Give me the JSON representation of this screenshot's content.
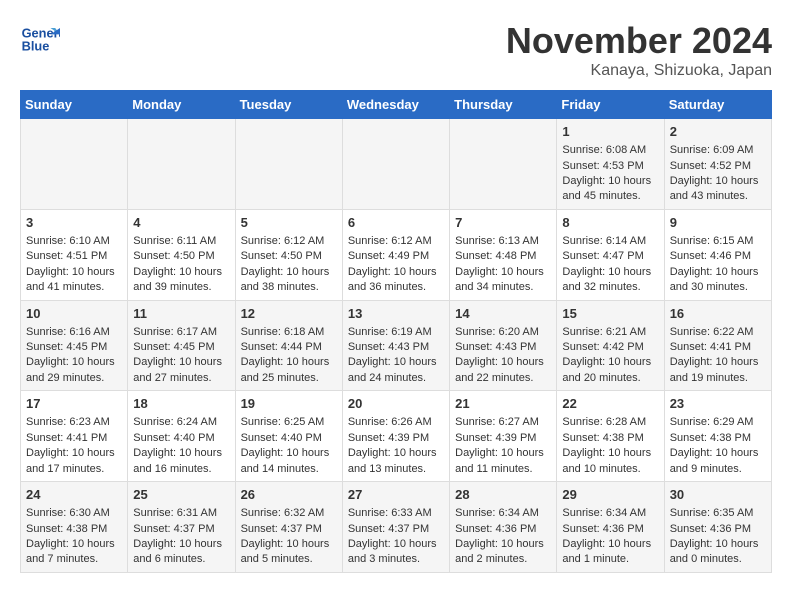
{
  "header": {
    "logo_line1": "General",
    "logo_line2": "Blue",
    "month": "November 2024",
    "location": "Kanaya, Shizuoka, Japan"
  },
  "weekdays": [
    "Sunday",
    "Monday",
    "Tuesday",
    "Wednesday",
    "Thursday",
    "Friday",
    "Saturday"
  ],
  "weeks": [
    [
      {
        "day": "",
        "info": ""
      },
      {
        "day": "",
        "info": ""
      },
      {
        "day": "",
        "info": ""
      },
      {
        "day": "",
        "info": ""
      },
      {
        "day": "",
        "info": ""
      },
      {
        "day": "1",
        "info": "Sunrise: 6:08 AM\nSunset: 4:53 PM\nDaylight: 10 hours\nand 45 minutes."
      },
      {
        "day": "2",
        "info": "Sunrise: 6:09 AM\nSunset: 4:52 PM\nDaylight: 10 hours\nand 43 minutes."
      }
    ],
    [
      {
        "day": "3",
        "info": "Sunrise: 6:10 AM\nSunset: 4:51 PM\nDaylight: 10 hours\nand 41 minutes."
      },
      {
        "day": "4",
        "info": "Sunrise: 6:11 AM\nSunset: 4:50 PM\nDaylight: 10 hours\nand 39 minutes."
      },
      {
        "day": "5",
        "info": "Sunrise: 6:12 AM\nSunset: 4:50 PM\nDaylight: 10 hours\nand 38 minutes."
      },
      {
        "day": "6",
        "info": "Sunrise: 6:12 AM\nSunset: 4:49 PM\nDaylight: 10 hours\nand 36 minutes."
      },
      {
        "day": "7",
        "info": "Sunrise: 6:13 AM\nSunset: 4:48 PM\nDaylight: 10 hours\nand 34 minutes."
      },
      {
        "day": "8",
        "info": "Sunrise: 6:14 AM\nSunset: 4:47 PM\nDaylight: 10 hours\nand 32 minutes."
      },
      {
        "day": "9",
        "info": "Sunrise: 6:15 AM\nSunset: 4:46 PM\nDaylight: 10 hours\nand 30 minutes."
      }
    ],
    [
      {
        "day": "10",
        "info": "Sunrise: 6:16 AM\nSunset: 4:45 PM\nDaylight: 10 hours\nand 29 minutes."
      },
      {
        "day": "11",
        "info": "Sunrise: 6:17 AM\nSunset: 4:45 PM\nDaylight: 10 hours\nand 27 minutes."
      },
      {
        "day": "12",
        "info": "Sunrise: 6:18 AM\nSunset: 4:44 PM\nDaylight: 10 hours\nand 25 minutes."
      },
      {
        "day": "13",
        "info": "Sunrise: 6:19 AM\nSunset: 4:43 PM\nDaylight: 10 hours\nand 24 minutes."
      },
      {
        "day": "14",
        "info": "Sunrise: 6:20 AM\nSunset: 4:43 PM\nDaylight: 10 hours\nand 22 minutes."
      },
      {
        "day": "15",
        "info": "Sunrise: 6:21 AM\nSunset: 4:42 PM\nDaylight: 10 hours\nand 20 minutes."
      },
      {
        "day": "16",
        "info": "Sunrise: 6:22 AM\nSunset: 4:41 PM\nDaylight: 10 hours\nand 19 minutes."
      }
    ],
    [
      {
        "day": "17",
        "info": "Sunrise: 6:23 AM\nSunset: 4:41 PM\nDaylight: 10 hours\nand 17 minutes."
      },
      {
        "day": "18",
        "info": "Sunrise: 6:24 AM\nSunset: 4:40 PM\nDaylight: 10 hours\nand 16 minutes."
      },
      {
        "day": "19",
        "info": "Sunrise: 6:25 AM\nSunset: 4:40 PM\nDaylight: 10 hours\nand 14 minutes."
      },
      {
        "day": "20",
        "info": "Sunrise: 6:26 AM\nSunset: 4:39 PM\nDaylight: 10 hours\nand 13 minutes."
      },
      {
        "day": "21",
        "info": "Sunrise: 6:27 AM\nSunset: 4:39 PM\nDaylight: 10 hours\nand 11 minutes."
      },
      {
        "day": "22",
        "info": "Sunrise: 6:28 AM\nSunset: 4:38 PM\nDaylight: 10 hours\nand 10 minutes."
      },
      {
        "day": "23",
        "info": "Sunrise: 6:29 AM\nSunset: 4:38 PM\nDaylight: 10 hours\nand 9 minutes."
      }
    ],
    [
      {
        "day": "24",
        "info": "Sunrise: 6:30 AM\nSunset: 4:38 PM\nDaylight: 10 hours\nand 7 minutes."
      },
      {
        "day": "25",
        "info": "Sunrise: 6:31 AM\nSunset: 4:37 PM\nDaylight: 10 hours\nand 6 minutes."
      },
      {
        "day": "26",
        "info": "Sunrise: 6:32 AM\nSunset: 4:37 PM\nDaylight: 10 hours\nand 5 minutes."
      },
      {
        "day": "27",
        "info": "Sunrise: 6:33 AM\nSunset: 4:37 PM\nDaylight: 10 hours\nand 3 minutes."
      },
      {
        "day": "28",
        "info": "Sunrise: 6:34 AM\nSunset: 4:36 PM\nDaylight: 10 hours\nand 2 minutes."
      },
      {
        "day": "29",
        "info": "Sunrise: 6:34 AM\nSunset: 4:36 PM\nDaylight: 10 hours\nand 1 minute."
      },
      {
        "day": "30",
        "info": "Sunrise: 6:35 AM\nSunset: 4:36 PM\nDaylight: 10 hours\nand 0 minutes."
      }
    ]
  ]
}
